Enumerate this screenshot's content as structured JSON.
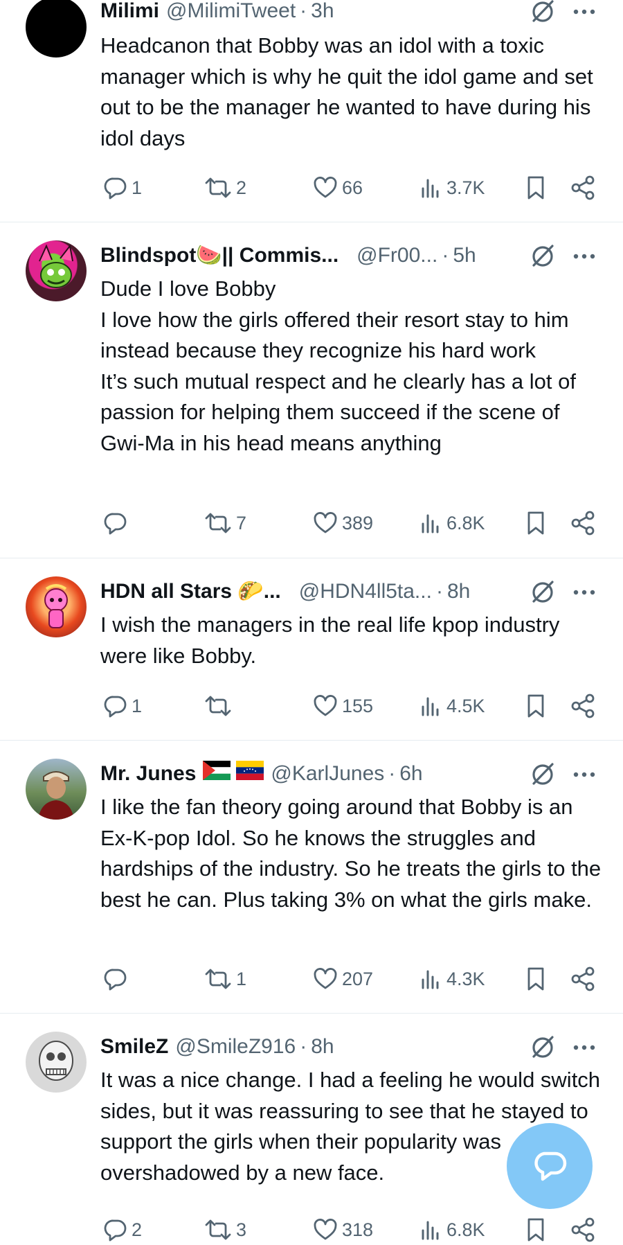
{
  "tweets": [
    {
      "name": "Milimi",
      "handle": "@MilimiTweet",
      "time": "3h",
      "text": "Headcanon that Bobby was an idol with a toxic manager which is why he quit the idol game and set out to be the manager he wanted to have during his idol days",
      "replies": "1",
      "reposts": "2",
      "likes": "66",
      "views": "3.7K"
    },
    {
      "name": "Blindspot🍉|| Commis...",
      "handle": "@Fr00...",
      "time": "5h",
      "text": "Dude I love Bobby\nI love how the girls offered their resort stay to him instead because they recognize his hard work\nIt’s such mutual respect and he clearly has a lot of passion for helping them succeed if the scene of Gwi-Ma in his head means anything",
      "replies": "",
      "reposts": "7",
      "likes": "389",
      "views": "6.8K"
    },
    {
      "name": "HDN all Stars 🌮...",
      "handle": "@HDN4ll5ta...",
      "time": "8h",
      "text": "I wish the managers in the real life kpop industry were like Bobby.",
      "replies": "1",
      "reposts": "",
      "likes": "155",
      "views": "4.5K"
    },
    {
      "name": "Mr. Junes",
      "handle": "@KarlJunes",
      "time": "6h",
      "text": "I like the fan theory going around that Bobby is an Ex-K-pop Idol. So he knows the struggles and hardships of the industry. So he treats the girls to the best he can. Plus taking 3% on what the girls make.",
      "replies": "",
      "reposts": "1",
      "likes": "207",
      "views": "4.3K"
    },
    {
      "name": "SmileZ",
      "handle": "@SmileZ916",
      "time": "8h",
      "text": "It was a nice change. I had a feeling he would switch sides, but it was reassuring to see that he stayed to support the girls when their popularity was overshadowed by a new face.",
      "replies": "2",
      "reposts": "3",
      "likes": "318",
      "views": "6.8K"
    }
  ],
  "separator": "·",
  "icons": {
    "reply": "reply-icon",
    "repost": "repost-icon",
    "like": "heart-icon",
    "views": "views-icon",
    "bookmark": "bookmark-icon",
    "share": "share-icon",
    "grok": "grok-icon",
    "more": "more-icon",
    "compose": "compose-reply-fab"
  },
  "colors": {
    "text": "#0f1419",
    "secondary": "#536471",
    "fab": "#1d9bf0"
  }
}
